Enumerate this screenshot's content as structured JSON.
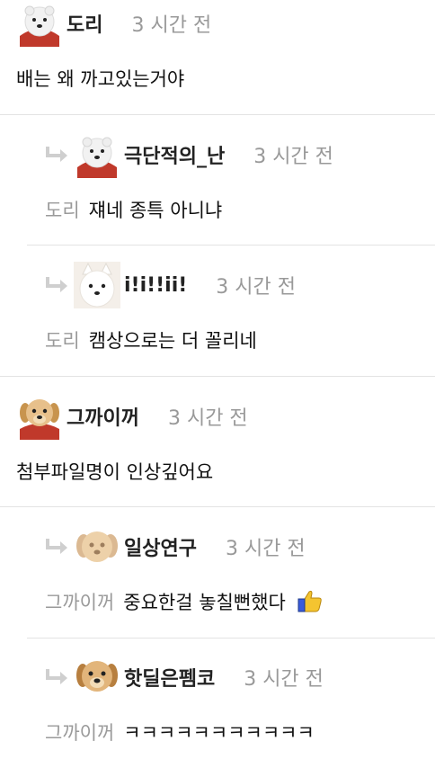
{
  "comments": [
    {
      "nick": "도리",
      "time": "3 시간 전",
      "text": "배는 왜 까고있는거야",
      "mention": "",
      "avatar": "polar-bear-avatar"
    },
    {
      "nick": "극단적의_난",
      "time": "3 시간 전",
      "text": "쟤네 종특 아니냐",
      "mention": "도리",
      "avatar": "polar-bear-avatar"
    },
    {
      "nick": "i!i!!ii!",
      "time": "3 시간 전",
      "text": "캠상으로는 더 꼴리네",
      "mention": "도리",
      "avatar": "white-dog-avatar"
    },
    {
      "nick": "그까이꺼",
      "time": "3 시간 전",
      "text": "첨부파일명이 인상깊어요",
      "mention": "",
      "avatar": "puppy-avatar"
    },
    {
      "nick": "일상연구",
      "time": "3 시간 전",
      "text": "중요한걸 놓칠뻔했다",
      "mention": "그까이꺼",
      "emoji": "👍",
      "avatar": "blurred-puppy-avatar"
    },
    {
      "nick": "핫딜은펨코",
      "time": "3 시간 전",
      "text": "ㅋㅋㅋㅋㅋㅋㅋㅋㅋㅋㅋ",
      "mention": "그까이꺼",
      "avatar": "puppy-face-avatar"
    }
  ],
  "colors": {
    "separator": "#e3e3e3",
    "mention": "#9a9a9a",
    "time": "#999999",
    "reply_arrow": "#cfcfcf"
  }
}
